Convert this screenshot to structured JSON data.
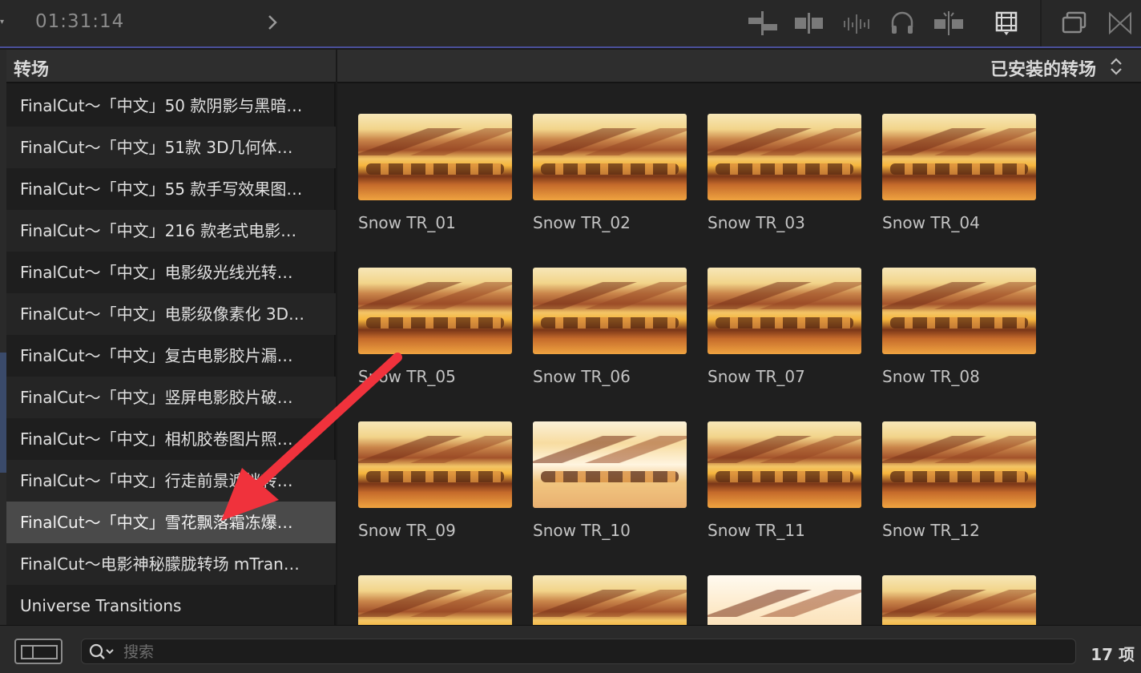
{
  "toolbar": {
    "timecode": "01:31:14",
    "icons": [
      "connect-clip-icon",
      "insert-clip-icon",
      "audio-waveform-icon",
      "headphones-icon",
      "skimming-icon",
      "filmstrip-icon",
      "window-icon",
      "bowtie-icon"
    ]
  },
  "sidebar": {
    "title": "转场",
    "items": [
      {
        "label": "FinalCut～「中文」50 款阴影与黑暗…"
      },
      {
        "label": "FinalCut～「中文」51款 3D几何体…"
      },
      {
        "label": "FinalCut～「中文」55 款手写效果图…"
      },
      {
        "label": "FinalCut～「中文」216 款老式电影…"
      },
      {
        "label": "FinalCut～「中文」电影级光线光转…"
      },
      {
        "label": "FinalCut～「中文」电影级像素化 3D…"
      },
      {
        "label": "FinalCut～「中文」复古电影胶片漏…"
      },
      {
        "label": "FinalCut～「中文」竖屏电影胶片破…"
      },
      {
        "label": "FinalCut～「中文」相机胶卷图片照…"
      },
      {
        "label": "FinalCut～「中文」行走前景遮挡转…"
      },
      {
        "label": "FinalCut～「中文」雪花飘落霜冻爆…"
      },
      {
        "label": "FinalCut～电影神秘朦胧转场 mTran…"
      },
      {
        "label": "Universe Transitions"
      }
    ],
    "selected_index": 10
  },
  "main": {
    "filter_label": "已安装的转场",
    "tiles": [
      {
        "label": "Snow TR_01"
      },
      {
        "label": "Snow TR_02"
      },
      {
        "label": "Snow TR_03"
      },
      {
        "label": "Snow TR_04"
      },
      {
        "label": "Snow TR_05"
      },
      {
        "label": "Snow TR_06"
      },
      {
        "label": "Snow TR_07"
      },
      {
        "label": "Snow TR_08"
      },
      {
        "label": "Snow TR_09"
      },
      {
        "label": "Snow TR_10"
      },
      {
        "label": "Snow TR_11"
      },
      {
        "label": "Snow TR_12"
      },
      {
        "label": ""
      },
      {
        "label": ""
      },
      {
        "label": ""
      },
      {
        "label": ""
      }
    ]
  },
  "bottom": {
    "search_placeholder": "搜索",
    "item_count": "17 项"
  },
  "colors": {
    "accent_line": "#4a4f9a",
    "annotation_arrow": "#f0323c",
    "selected_row": "#4a4a4a"
  }
}
